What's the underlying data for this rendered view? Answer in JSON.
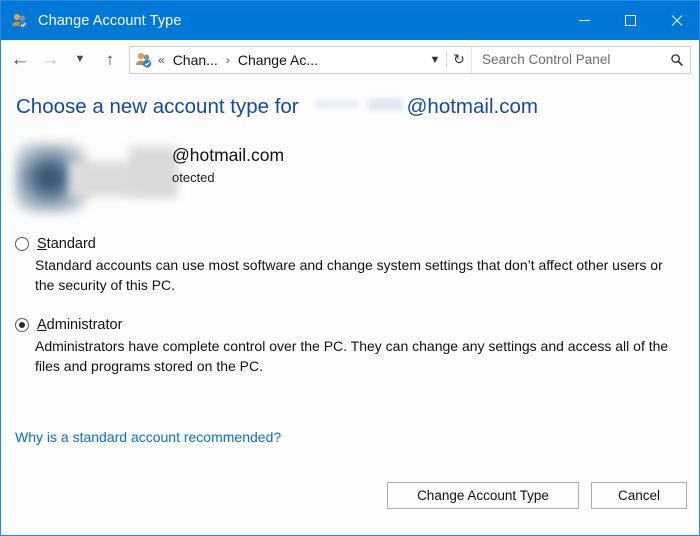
{
  "window": {
    "title": "Change Account Type",
    "title_icon": "users-icon",
    "caption": {
      "minimize_label": "Minimize",
      "maximize_label": "Maximize",
      "close_label": "Close"
    },
    "accent_color": "#0078d7",
    "border_color": "#2b88d8"
  },
  "nav": {
    "back_label": "Back",
    "forward_label": "Forward",
    "recent_label": "Recent locations",
    "up_label": "Up",
    "refresh_label": "Refresh",
    "history_label": "Previous locations",
    "breadcrumb_icon": "users-icon",
    "breadcrumb_overflow": "«",
    "breadcrumb": [
      {
        "label": "Chan..."
      },
      {
        "label": "Change Ac..."
      }
    ],
    "breadcrumb_separator": "›"
  },
  "search": {
    "placeholder": "Search Control Panel",
    "value": "",
    "icon": "search-icon"
  },
  "main": {
    "heading_prefix": "Choose a new account type for",
    "heading_suffix": "@hotmail.com",
    "heading_redacted": true,
    "heading_color": "#14499b",
    "account": {
      "avatar": "user-avatar-blurred",
      "name": "@hotmail.com",
      "name_redacted": true,
      "subtitle": "otected",
      "subtitle_redacted": true
    },
    "options": [
      {
        "id": "standard",
        "accelerator": "S",
        "label_rest": "tandard",
        "selected": false,
        "description": "Standard accounts can use most software and change system settings that don’t affect other users or the security of this PC."
      },
      {
        "id": "administrator",
        "accelerator": "A",
        "label_rest": "dministrator",
        "selected": true,
        "description": "Administrators have complete control over the PC. They can change any settings and access all of the files and programs stored on the PC."
      }
    ],
    "help_link": "Why is a standard account recommended?",
    "help_link_color": "#0b6ec7"
  },
  "footer": {
    "primary_label": "Change Account Type",
    "cancel_label": "Cancel"
  }
}
